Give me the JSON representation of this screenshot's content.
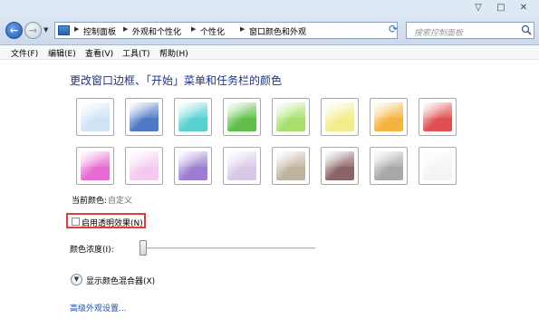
{
  "window": {
    "controls": {
      "minimize": "▽",
      "maximize": "□",
      "close": "✕"
    }
  },
  "address_bar": {
    "breadcrumbs": [
      "控制面板",
      "外观和个性化",
      "个性化",
      "窗口颜色和外观"
    ],
    "search_placeholder": "搜索控制面板",
    "icons": {
      "back": "back-arrow-icon",
      "forward": "forward-arrow-icon",
      "refresh": "refresh-icon",
      "search": "search-icon"
    }
  },
  "menubar": {
    "items": [
      "文件(F)",
      "编辑(E)",
      "查看(V)",
      "工具(T)",
      "帮助(H)"
    ]
  },
  "main": {
    "heading": "更改窗口边框、「开始」菜单和任务栏的颜色",
    "swatches": [
      {
        "name": "sky",
        "color": "#cfe3f7"
      },
      {
        "name": "twilight",
        "color": "#4f79c6"
      },
      {
        "name": "sea",
        "color": "#59d0d0"
      },
      {
        "name": "leaf",
        "color": "#5fbf4a"
      },
      {
        "name": "lime",
        "color": "#a9df6e"
      },
      {
        "name": "pumpkin-light",
        "color": "#f3ec8a"
      },
      {
        "name": "pumpkin",
        "color": "#f6b341"
      },
      {
        "name": "ruby",
        "color": "#de4f4f"
      },
      {
        "name": "fuchsia",
        "color": "#e86bd1"
      },
      {
        "name": "blush",
        "color": "#f5c8ef"
      },
      {
        "name": "violet",
        "color": "#9c7fd0"
      },
      {
        "name": "lavender",
        "color": "#d8c8e6"
      },
      {
        "name": "taupe",
        "color": "#bfb49f"
      },
      {
        "name": "chocolate",
        "color": "#8a6466"
      },
      {
        "name": "slate",
        "color": "#a8a8a8"
      },
      {
        "name": "frost",
        "color": "#f4f4f4"
      }
    ],
    "current_color_label": "当前颜色:",
    "current_color_value": "自定义",
    "transparency": {
      "label": "启用透明效果(N)",
      "checked": false
    },
    "intensity": {
      "label": "颜色浓度(I):",
      "value": 0
    },
    "mixer_label": "显示颜色混合器(X)",
    "advanced_link": "高级外观设置..."
  }
}
